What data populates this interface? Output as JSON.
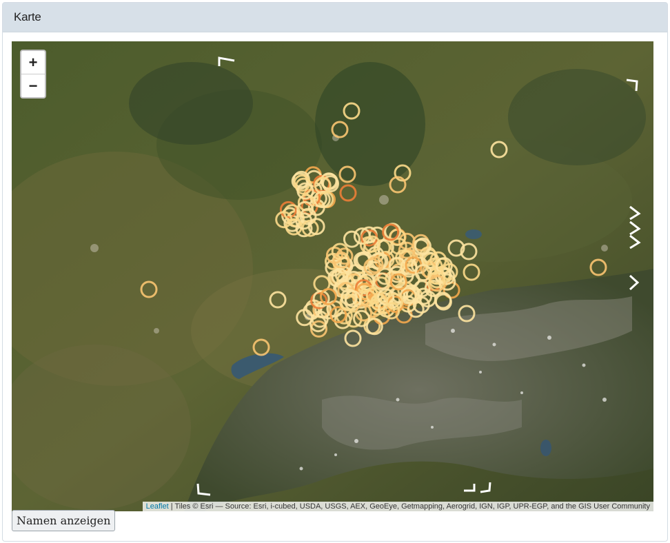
{
  "panel": {
    "title": "Karte"
  },
  "map": {
    "zoom_in_label": "+",
    "zoom_out_label": "−",
    "attribution_link": "Leaflet",
    "attribution_text": " | Tiles © Esri — Source: Esri, i-cubed, USDA, USGS, AEX, GeoEye, Getmapping, Aerogrid, IGN, IGP, UPR-EGP, and the GIS User Community",
    "marker_colors": [
      "#fde3a0",
      "#fbd98a",
      "#f8c471",
      "#f4a94e",
      "#ec7e37"
    ]
  },
  "controls": {
    "names_button": "Namen anzeigen"
  }
}
